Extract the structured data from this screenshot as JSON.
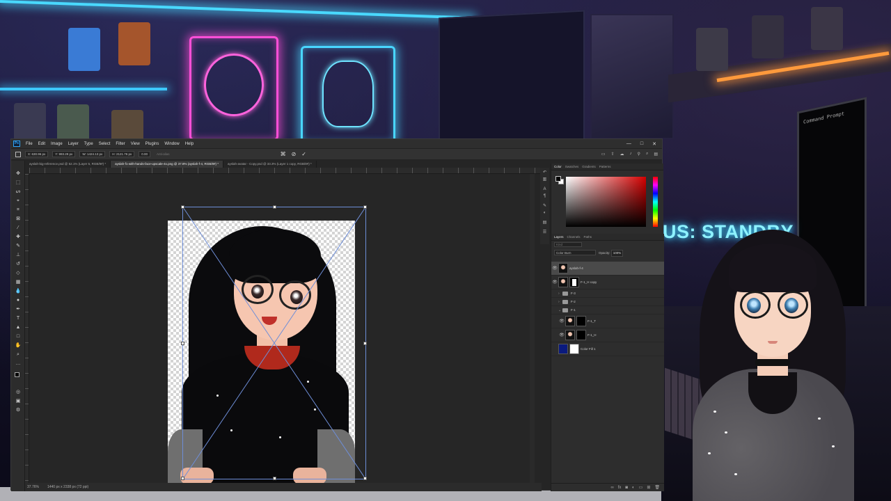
{
  "background": {
    "monitor_title": "Command Prompt",
    "neon_sign_text": "US: STANDBY"
  },
  "app": {
    "logo": "Ps",
    "menu": [
      "File",
      "Edit",
      "Image",
      "Layer",
      "Type",
      "Select",
      "Filter",
      "View",
      "Plugins",
      "Window",
      "Help"
    ],
    "window_controls": [
      "—",
      "□",
      "✕"
    ]
  },
  "options_bar": {
    "x": "X: 630.96 px",
    "y": "Y: 993.29 px",
    "w": "W: 1424.13 px",
    "h": "H: 2121.76 px",
    "angle": "0.00",
    "interpolation": "Anti-alias",
    "cancel_icon": "cancel-transform-icon",
    "commit_icon": "commit-transform-icon"
  },
  "tabs": [
    {
      "label": "ayslah-big-reference.psd @ 52.1% (Layer 5, RGB/8#) *",
      "active": false
    },
    {
      "label": "ayslah-f1-with-hands-face-upscale-4x.png @ 37.8% (ayslah-f-4, RGB/8#) *",
      "active": true
    },
    {
      "label": "ayslah-avatar - Copy.psd @ 33.3% (Layer 1 copy, RGB/8#) *",
      "active": false
    }
  ],
  "status": {
    "zoom": "37.76%",
    "doc_info": "1440 px x 2338 px (72 ppi)"
  },
  "color_panel": {
    "tabs": [
      "Color",
      "Swatches",
      "Gradients",
      "Patterns"
    ],
    "active_tab": "Color",
    "foreground": "#000000",
    "background": "#ffffff",
    "hue_color": "#d40000"
  },
  "layers_panel": {
    "tabs": [
      "Layers",
      "Channels",
      "Paths"
    ],
    "active_tab": "Layers",
    "search_kind": "Kind",
    "blend_mode": "Color Burn",
    "opacity_label": "Opacity:",
    "opacity": "100%",
    "fill_label": "Fill:",
    "fill": "100%",
    "layers": [
      {
        "name": "ayslah-f-4",
        "visible": true,
        "selected": true,
        "type": "pixel"
      },
      {
        "name": "F-1_H copy",
        "visible": true,
        "selected": false,
        "type": "masked"
      },
      {
        "name": "F-3",
        "visible": false,
        "selected": false,
        "type": "group"
      },
      {
        "name": "F-2",
        "visible": false,
        "selected": false,
        "type": "group"
      },
      {
        "name": "F-1",
        "visible": false,
        "selected": false,
        "type": "group-open"
      },
      {
        "name": "F-1_T",
        "visible": true,
        "selected": false,
        "type": "masked-child"
      },
      {
        "name": "F-1_H",
        "visible": true,
        "selected": false,
        "type": "masked-child"
      },
      {
        "name": "Color Fill 1",
        "visible": false,
        "selected": false,
        "type": "fill"
      }
    ]
  }
}
